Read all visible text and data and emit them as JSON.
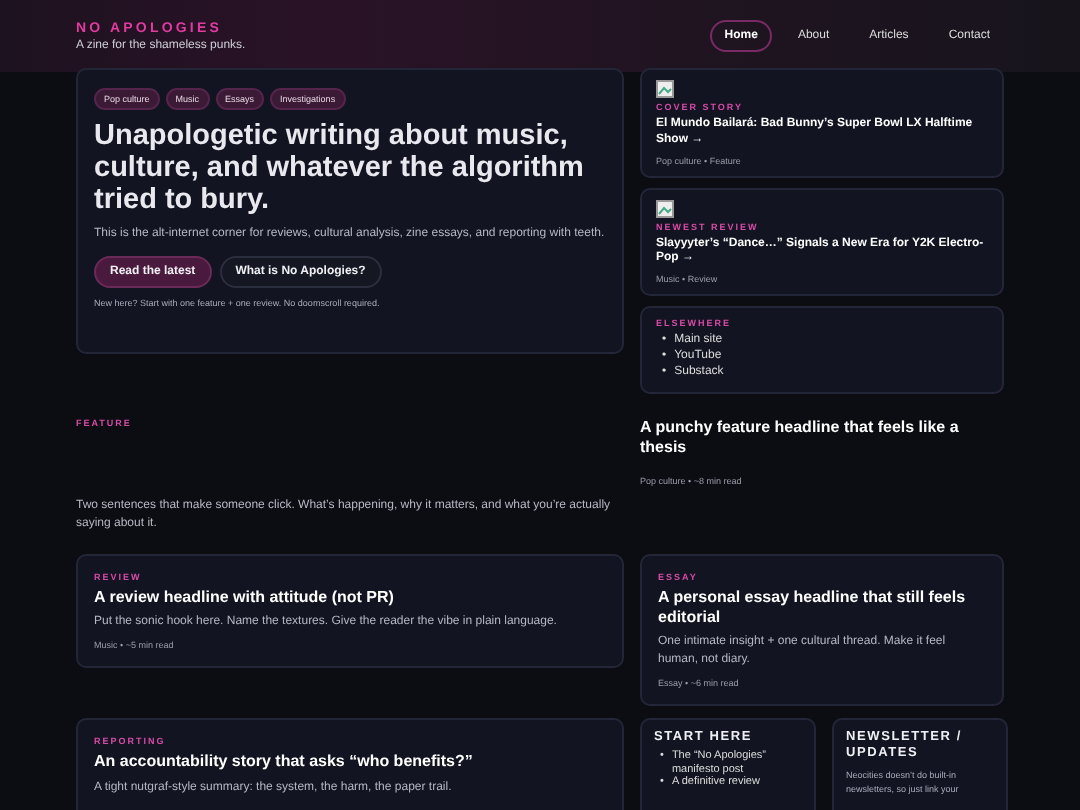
{
  "site": {
    "name": "NO APOLOGIES",
    "tagline": "A zine for the shameless punks."
  },
  "nav": [
    {
      "label": "Home",
      "selected": true
    },
    {
      "label": "About",
      "selected": false
    },
    {
      "label": "Articles",
      "selected": false
    },
    {
      "label": "Contact",
      "selected": false
    }
  ],
  "hero": {
    "tags": [
      "Pop culture",
      "Music",
      "Essays",
      "Investigations"
    ],
    "headline": "Unapologetic writing about music, culture, and whatever the algorithm tried to bury.",
    "intro": "This is the alt-internet corner for reviews, cultural analysis, zine essays, and reporting with teeth.",
    "primary_button": "Read the latest",
    "secondary_button": "What is No Apologies?",
    "note": "New here? Start with one feature + one review. No doomscroll required."
  },
  "side_cards": [
    {
      "kicker": "COVER STORY",
      "title": "El Mundo Bailará: Bad Bunny’s Super Bowl LX Halftime Show →",
      "meta": "Pop culture • Feature"
    },
    {
      "kicker": "NEWEST REVIEW",
      "title": "Slayyyter’s “Dance…” Signals a New Era for Y2K Electro-Pop →",
      "meta": "Music • Review"
    }
  ],
  "elsewhere": {
    "kicker": "ELSEWHERE",
    "marker": "•",
    "links": [
      "Main site",
      "YouTube",
      "Substack"
    ]
  },
  "feature": {
    "kicker": "FEATURE",
    "summary": "Two sentences that make someone click. What’s happening, why it matters, and what you’re actually saying about it.",
    "headline": "A punchy feature headline that feels like a thesis",
    "meta": "Pop culture • ~8 min read"
  },
  "cards": [
    {
      "kicker": "REVIEW",
      "headline": "A review headline with attitude (not PR)",
      "summary": "Put the sonic hook here. Name the textures. Give the reader the vibe in plain language.",
      "meta": "Music • ~5 min read"
    },
    {
      "kicker": "ESSAY",
      "headline": "A personal essay headline that still feels editorial",
      "summary": "One intimate insight + one cultural thread. Make it feel human, not diary.",
      "meta": "Essay • ~6 min read"
    }
  ],
  "reporting": {
    "kicker": "REPORTING",
    "headline": "An accountability story that asks “who benefits?”",
    "summary": "A tight nutgraf-style summary: the system, the harm, the paper trail."
  },
  "start_here": {
    "title": "START HERE",
    "marker": "•",
    "items": [
      "The “No Apologies” manifesto post",
      "A definitive review"
    ]
  },
  "newsletter": {
    "title": "NEWSLETTER / UPDATES",
    "text": "Neocities doesn’t do built-in newsletters, so just link your"
  }
}
